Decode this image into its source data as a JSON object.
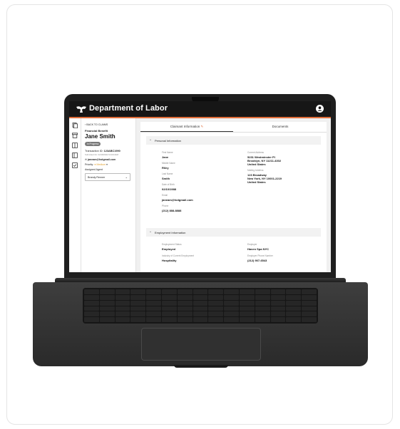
{
  "app": {
    "title": "Department of Labor"
  },
  "claim": {
    "back_label": "BACK TO CLAIMS",
    "program": "Financial Benefit",
    "name": "Jane Smith",
    "status": "In Progress",
    "transaction_label": "Transaction ID: ",
    "transaction_id": "123ABC1990",
    "submitted": "Submitted On: 02/18/2022 9:04:04AM",
    "email": "janeam@hotgmail.com",
    "priority_label": "Priority: ",
    "priority_value": "Medium",
    "assigned_label": "Assigned Agent",
    "assigned_value": "Brandy Renner"
  },
  "tabs": {
    "claimant": "Claimant Information",
    "documents": "Documents"
  },
  "personal": {
    "title": "Personal Information",
    "first_name_label": "First Name",
    "first_name": "Jane",
    "middle_name_label": "Middle Name",
    "middle_name": "Riley",
    "last_name_label": "Last Name",
    "last_name": "Smith",
    "dob_label": "Date of Birth",
    "dob": "02/10/1988",
    "email_label": "Email",
    "email": "janeam@hotgmail.com",
    "phone_label": "Phone",
    "phone": "(212) 888-8888",
    "current_address_label": "Current Address",
    "current_address_1": "5231 Westminster Pl",
    "current_address_2": "Brooklyn, NY 11211-4302",
    "current_address_3": "United States",
    "mailing_address_label": "Mailing Address",
    "mailing_address_1": "123 Broadway",
    "mailing_address_2": "New York, NY 10001-2219",
    "mailing_address_3": "United States"
  },
  "employment": {
    "title": "Employment Information",
    "status_label": "Employment Status",
    "status": "Employed",
    "employer_label": "Employer",
    "employer": "Haven Spa NYC",
    "industry_label": "Industry of Current Employment",
    "industry": "Hospitality",
    "employer_phone_label": "Employer Phone Number",
    "employer_phone": "(212) 907-6543"
  },
  "colors": {
    "header_bg": "#161616",
    "accent": "#e06d3a",
    "status_pill": "#7a7a7a",
    "priority": "#e0a030"
  }
}
